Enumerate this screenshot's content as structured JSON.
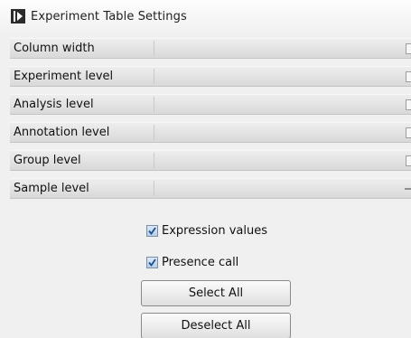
{
  "panel": {
    "title": "Experiment Table Settings",
    "toggle_icon": "play-triangle-icon"
  },
  "rows": [
    {
      "label": "Column width",
      "state": "collapsed"
    },
    {
      "label": "Experiment level",
      "state": "collapsed"
    },
    {
      "label": "Analysis level",
      "state": "collapsed"
    },
    {
      "label": "Annotation level",
      "state": "collapsed"
    },
    {
      "label": "Group level",
      "state": "collapsed"
    },
    {
      "label": "Sample level",
      "state": "expanded"
    }
  ],
  "sample_level": {
    "checkboxes": [
      {
        "label": "Expression values",
        "checked": true
      },
      {
        "label": "Presence call",
        "checked": true
      }
    ],
    "buttons": {
      "select_all": "Select All",
      "deselect_all": "Deselect All"
    }
  },
  "colors": {
    "checkbox_fill": "#b8cfe8",
    "check_mark": "#1f4f8f"
  }
}
